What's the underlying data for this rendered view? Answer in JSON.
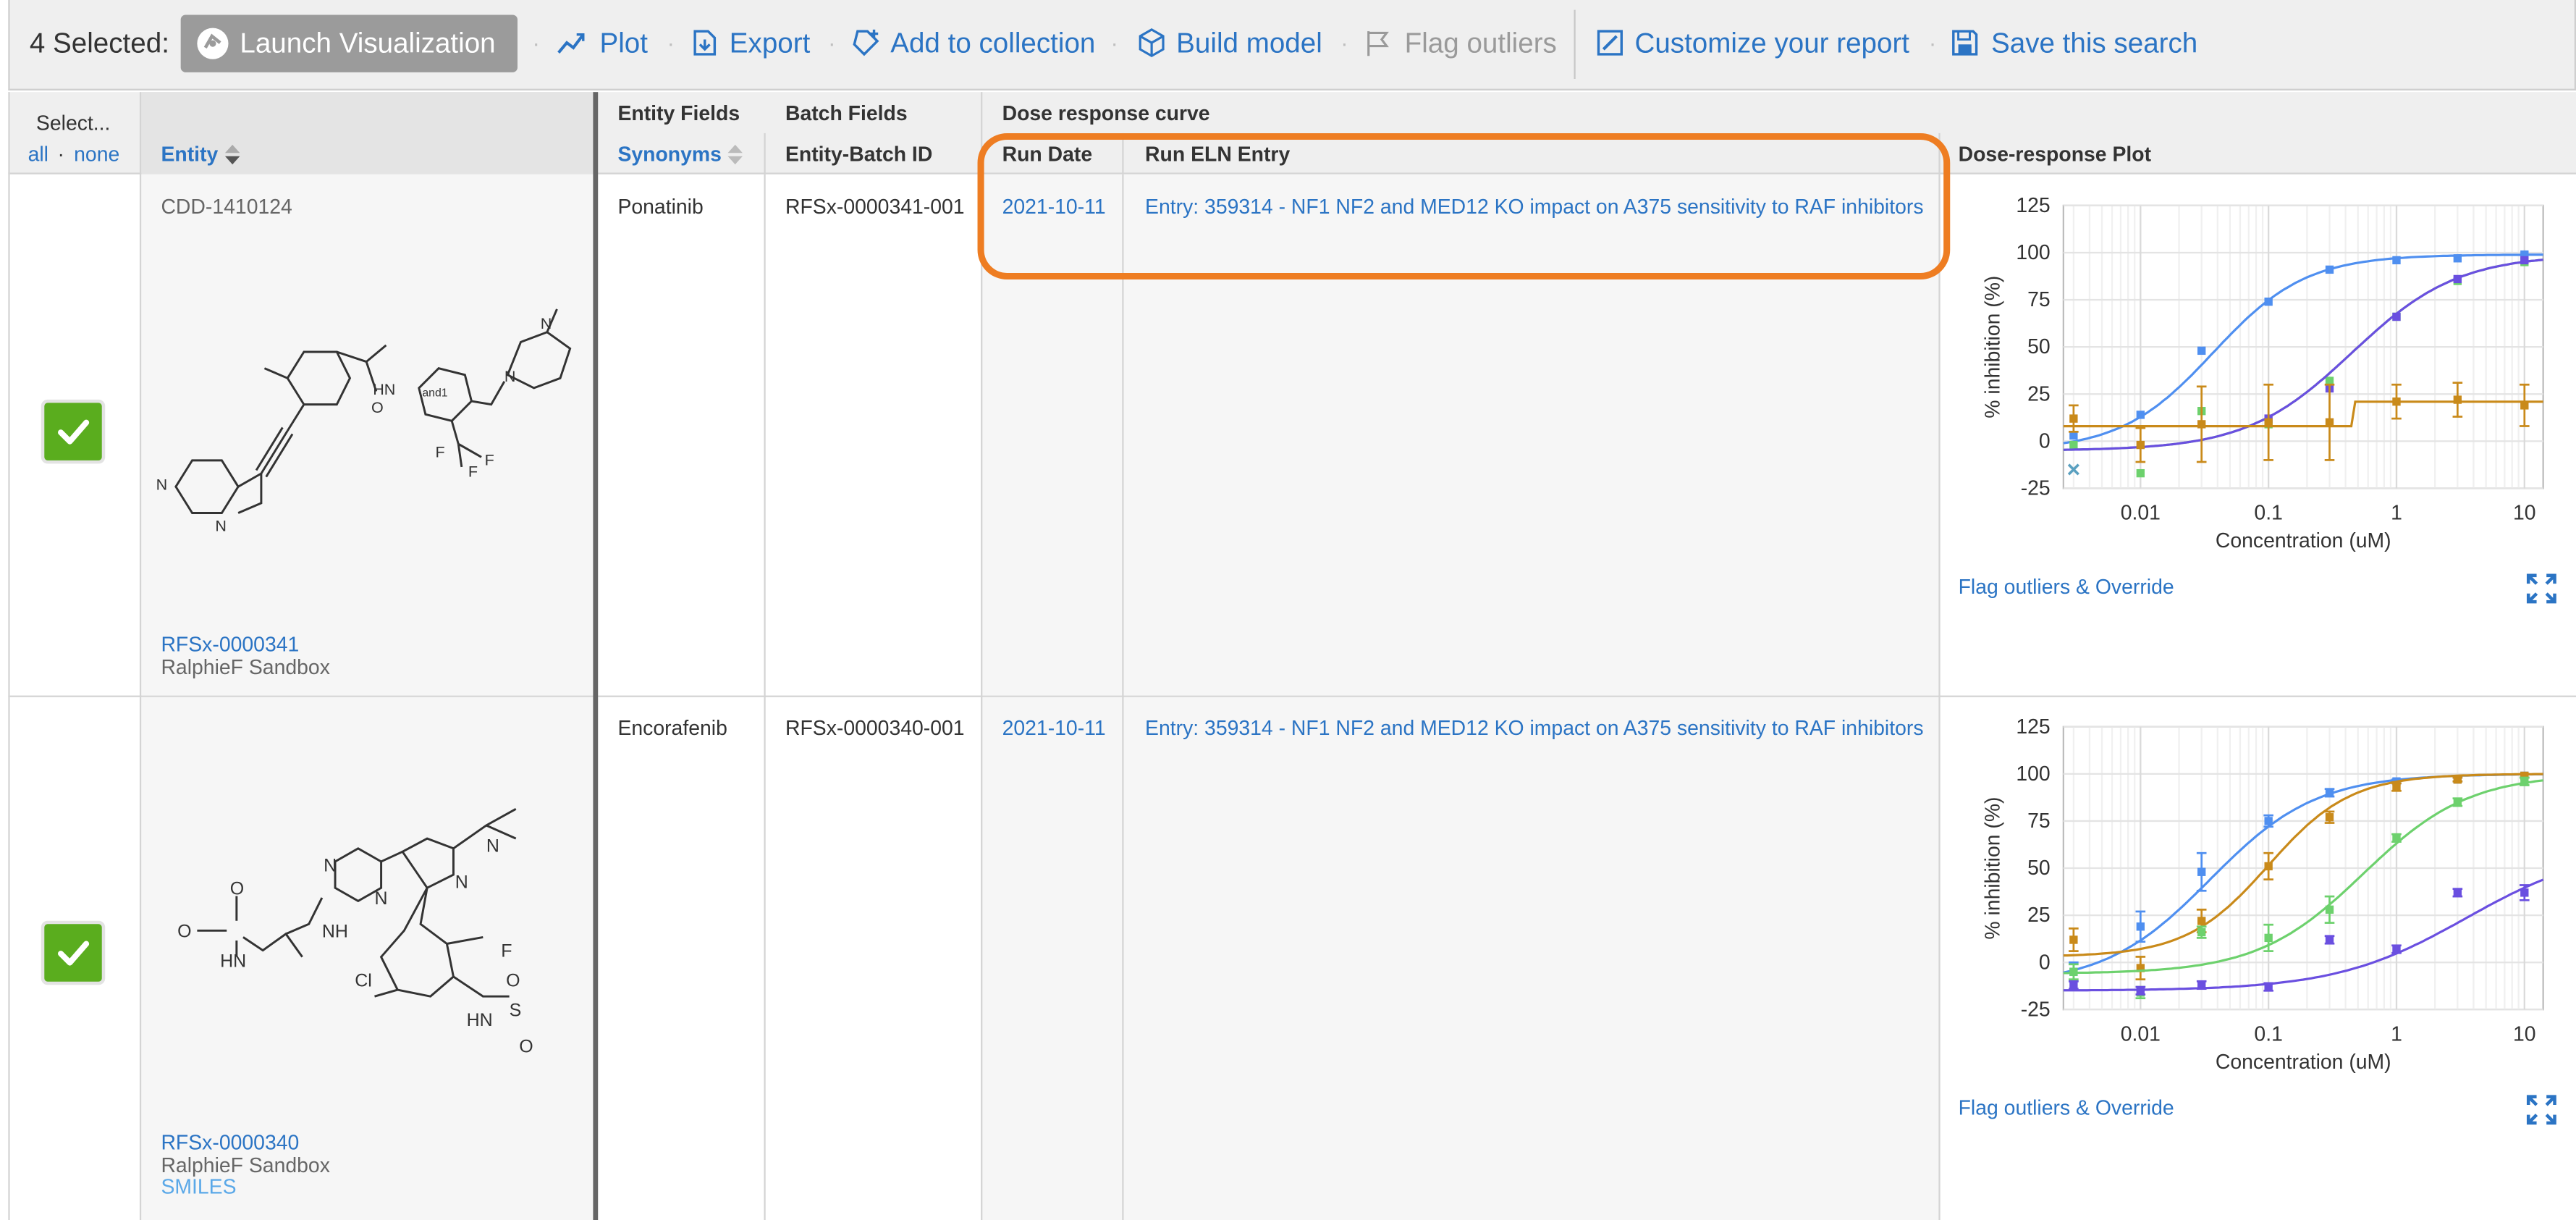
{
  "toolbar": {
    "selected_label": "4 Selected:",
    "launch_label": "Launch Visualization",
    "plot_label": "Plot",
    "export_label": "Export",
    "add_collection_label": "Add to collection",
    "build_model_label": "Build model",
    "flag_outliers_label": "Flag outliers",
    "customize_label": "Customize your report",
    "save_search_label": "Save this search",
    "separator": "·"
  },
  "header": {
    "select_label": "Select...",
    "select_all": "all",
    "select_dot": "·",
    "select_none": "none",
    "entity_label": "Entity",
    "entity_fields_group": "Entity Fields",
    "synonyms_label": "Synonyms",
    "batch_fields_group": "Batch Fields",
    "entity_batch_id_label": "Entity-Batch ID",
    "dose_group": "Dose response curve",
    "run_date_label": "Run Date",
    "run_eln_label": "Run ELN Entry",
    "plot_label": "Dose-response Plot"
  },
  "rows": [
    {
      "cdd_id": "CDD-1410124",
      "molecule_label": "RFSx-0000341",
      "project": "RalphieF Sandbox",
      "synonym": "Ponatinib",
      "batch_id": "RFSx-0000341-001",
      "run_date": "2021-10-11",
      "eln_entry": "Entry: 359314 - NF1 NF2 and MED12 KO impact on A375 sensitivity to RAF inhibitors",
      "flag_link": "Flag outliers & Override",
      "structure_labels": {
        "amide_nh": "HN",
        "stereo": "and1",
        "f1": "F",
        "f2": "F",
        "f3": "F",
        "pyridazine_n": "N",
        "imidazo_n": "N",
        "amide_o": "O",
        "piperazine_n1": "N",
        "piperazine_n2": "N"
      }
    },
    {
      "molecule_label": "RFSx-0000340",
      "project": "RalphieF Sandbox",
      "smiles_link": "SMILES",
      "synonym": "Encorafenib",
      "batch_id": "RFSx-0000340-001",
      "run_date": "2021-10-11",
      "eln_entry": "Entry: 359314 - NF1 NF2 and MED12 KO impact on A375 sensitivity to RAF inhibitors",
      "flag_link": "Flag outliers & Override",
      "structure_labels": {
        "carb_o": "O",
        "methoxy_o": "O",
        "nh1": "HN",
        "nh2": "NH",
        "pyr_n1": "N",
        "pyr_n2": "N",
        "pz_n1": "N",
        "pz_n2": "N",
        "fluoro": "F",
        "chloro": "Cl",
        "sulf_nh": "HN",
        "sulf_s": "S",
        "sulf_o1": "O",
        "sulf_o2": "O"
      }
    }
  ],
  "chart_data": [
    {
      "type": "line",
      "title": "",
      "xlabel": "Concentration (uM)",
      "ylabel": "% inhibition (%)",
      "xscale": "log",
      "xlim": [
        0.0025,
        14
      ],
      "ylim": [
        -25,
        125
      ],
      "xticks": [
        0.01,
        0.1,
        1,
        10
      ],
      "xtick_labels": [
        "0.01",
        "0.1",
        "1",
        "10"
      ],
      "yticks": [
        -25,
        0,
        25,
        50,
        75,
        100,
        125
      ],
      "grid": true,
      "series": [
        {
          "color": "#4f8ff0",
          "x": [
            0.003,
            0.01,
            0.03,
            0.1,
            0.3,
            1,
            3,
            10
          ],
          "y": [
            3,
            14,
            48,
            74,
            91,
            96,
            97,
            99
          ],
          "fit": {
            "bottom": -5,
            "top": 99,
            "ec50": 0.037,
            "hill": 1.2
          }
        },
        {
          "color": "#6dd16d",
          "x": [
            0.003,
            0.01,
            0.03,
            0.1,
            0.3,
            1,
            3,
            10
          ],
          "y": [
            -2,
            -17,
            16,
            9,
            32,
            66,
            85,
            95
          ],
          "fit": {
            "bottom": -5,
            "top": 99,
            "ec50": 0.45,
            "hill": 1.05
          }
        },
        {
          "color": "#6a4fe0",
          "x": [
            0.1,
            0.3,
            1,
            3,
            10
          ],
          "y": [
            12,
            28,
            66,
            86,
            96
          ],
          "fit": {
            "bottom": -5,
            "top": 99,
            "ec50": 0.45,
            "hill": 1.05
          }
        },
        {
          "color": "#c98a1a",
          "x": [
            0.003,
            0.01,
            0.03,
            0.1,
            0.3,
            1,
            3,
            10
          ],
          "y": [
            12,
            -2,
            9,
            10,
            10,
            21,
            22,
            19
          ],
          "err": [
            7,
            9,
            20,
            20,
            20,
            9,
            9,
            11
          ],
          "fit": {
            "step_from": 8,
            "step_to": 21,
            "step_at": 0.45
          }
        },
        {
          "color": "#5aa0c0",
          "x": [
            0.003
          ],
          "y": [
            -15
          ],
          "marker": "x"
        }
      ]
    },
    {
      "type": "line",
      "title": "",
      "xlabel": "Concentration (uM)",
      "ylabel": "% inhibition (%)",
      "xscale": "log",
      "xlim": [
        0.0025,
        14
      ],
      "ylim": [
        -25,
        125
      ],
      "xticks": [
        0.01,
        0.1,
        1,
        10
      ],
      "xtick_labels": [
        "0.01",
        "0.1",
        "1",
        "10"
      ],
      "yticks": [
        -25,
        0,
        25,
        50,
        75,
        100,
        125
      ],
      "grid": true,
      "series": [
        {
          "color": "#4f8ff0",
          "x": [
            0.003,
            0.01,
            0.03,
            0.1,
            0.3,
            1,
            3,
            10
          ],
          "y": [
            -5,
            19,
            48,
            75,
            90,
            96,
            97,
            99
          ],
          "err": [
            5,
            8,
            10,
            3,
            2,
            1,
            1,
            1
          ],
          "fit": {
            "bottom": -12,
            "top": 100,
            "ec50": 0.035,
            "hill": 1.05
          }
        },
        {
          "color": "#c98a1a",
          "x": [
            0.003,
            0.01,
            0.03,
            0.1,
            0.3,
            1,
            3,
            10
          ],
          "y": [
            12,
            -3,
            22,
            51,
            77,
            93,
            97,
            99
          ],
          "err": [
            6,
            6,
            6,
            7,
            3,
            2,
            1,
            1
          ],
          "fit": {
            "bottom": 3,
            "top": 100,
            "ec50": 0.1,
            "hill": 1.35
          }
        },
        {
          "color": "#6dd16d",
          "x": [
            0.003,
            0.01,
            0.03,
            0.1,
            0.3,
            1,
            3,
            10
          ],
          "y": [
            -5,
            -16,
            16,
            13,
            28,
            66,
            85,
            96
          ],
          "err": [
            4,
            3,
            3,
            7,
            7,
            2,
            2,
            2
          ],
          "fit": {
            "bottom": -6,
            "top": 100,
            "ec50": 0.55,
            "hill": 1.05
          }
        },
        {
          "color": "#6a4fe0",
          "x": [
            0.003,
            0.01,
            0.03,
            0.1,
            0.3,
            1,
            3,
            10
          ],
          "y": [
            -12,
            -15,
            -12,
            -13,
            12,
            7,
            37,
            37
          ],
          "err": [
            2,
            2,
            2,
            2,
            2,
            2,
            2,
            4
          ],
          "fit": {
            "bottom": -15,
            "top": 62,
            "ec50": 3.5,
            "hill": 0.85
          }
        }
      ]
    }
  ]
}
